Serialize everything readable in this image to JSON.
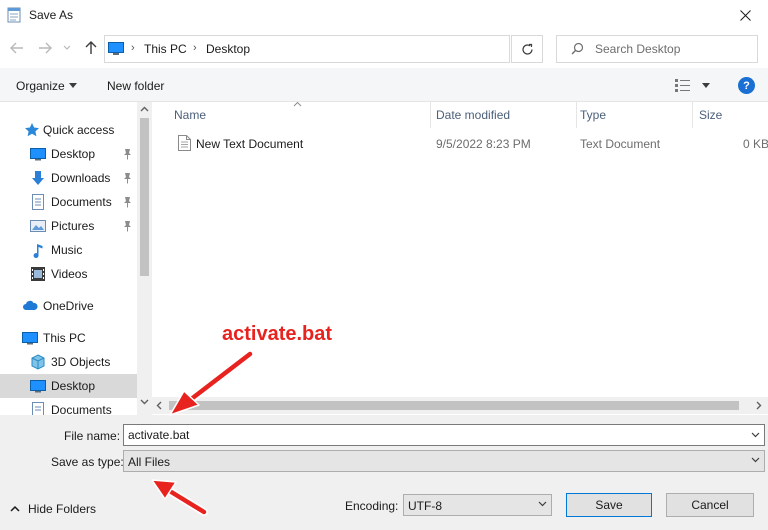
{
  "window": {
    "title": "Save As"
  },
  "address": {
    "crumbs": [
      "This PC",
      "Desktop"
    ]
  },
  "search": {
    "placeholder": "Search Desktop"
  },
  "toolbar": {
    "organize": "Organize",
    "new_folder": "New folder"
  },
  "nav": {
    "items": [
      {
        "label": "Quick access",
        "icon": "star-icon",
        "pinned": false
      },
      {
        "label": "Desktop",
        "icon": "desktop-icon",
        "pinned": true
      },
      {
        "label": "Downloads",
        "icon": "downloads-icon",
        "pinned": true
      },
      {
        "label": "Documents",
        "icon": "documents-icon",
        "pinned": true
      },
      {
        "label": "Pictures",
        "icon": "pictures-icon",
        "pinned": true
      },
      {
        "label": "Music",
        "icon": "music-icon",
        "pinned": false
      },
      {
        "label": "Videos",
        "icon": "videos-icon",
        "pinned": false
      },
      {
        "label": "OneDrive",
        "icon": "cloud-icon",
        "pinned": false
      },
      {
        "label": "This PC",
        "icon": "pc-icon",
        "pinned": false
      },
      {
        "label": "3D Objects",
        "icon": "cube-icon",
        "pinned": false
      },
      {
        "label": "Desktop",
        "icon": "desktop-icon",
        "pinned": false
      },
      {
        "label": "Documents",
        "icon": "documents-icon",
        "pinned": false
      }
    ]
  },
  "columns": {
    "name": "Name",
    "date": "Date modified",
    "type": "Type",
    "size": "Size"
  },
  "files": [
    {
      "name": "New Text Document",
      "date": "9/5/2022 8:23 PM",
      "type": "Text Document",
      "size": "0 KB"
    }
  ],
  "form": {
    "file_name_label": "File name:",
    "file_name_value": "activate.bat",
    "save_type_label": "Save as type:",
    "save_type_value": "All Files",
    "encoding_label": "Encoding:",
    "encoding_value": "UTF-8",
    "save": "Save",
    "cancel": "Cancel",
    "hide_folders": "Hide Folders"
  },
  "annotation": {
    "text": "activate.bat",
    "color": "#e8231f"
  },
  "colors": {
    "accent": "#0078d7",
    "selection": "#cce8ff"
  }
}
